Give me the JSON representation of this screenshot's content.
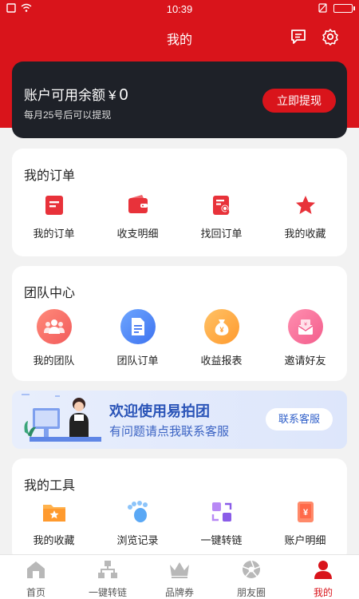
{
  "status_bar": {
    "time": "10:39"
  },
  "header": {
    "title": "我的",
    "message_icon": "message-icon",
    "settings_icon": "gear-icon"
  },
  "balance": {
    "label": "账户可用余额",
    "currency": "¥",
    "amount": "0",
    "note": "每月25号后可以提现",
    "withdraw_label": "立即提现"
  },
  "orders": {
    "title": "我的订单",
    "items": [
      {
        "label": "我的订单",
        "icon": "order-list-icon"
      },
      {
        "label": "收支明细",
        "icon": "wallet-icon"
      },
      {
        "label": "找回订单",
        "icon": "search-order-icon"
      },
      {
        "label": "我的收藏",
        "icon": "star-icon"
      }
    ]
  },
  "team": {
    "title": "团队中心",
    "items": [
      {
        "label": "我的团队",
        "icon": "team-icon"
      },
      {
        "label": "团队订单",
        "icon": "document-icon"
      },
      {
        "label": "收益报表",
        "icon": "money-bag-icon"
      },
      {
        "label": "邀请好友",
        "icon": "invite-icon"
      }
    ]
  },
  "banner": {
    "title": "欢迎使用易拍团",
    "subtitle": "有问题请点我联系客服",
    "button_label": "联系客服"
  },
  "tools": {
    "title": "我的工具",
    "items": [
      {
        "label": "我的收藏",
        "icon": "folder-star-icon"
      },
      {
        "label": "浏览记录",
        "icon": "footprint-icon"
      },
      {
        "label": "一键转链",
        "icon": "convert-link-icon"
      },
      {
        "label": "账户明细",
        "icon": "account-detail-icon"
      }
    ]
  },
  "tabbar": {
    "active": "我的",
    "tabs": [
      {
        "label": "首页",
        "icon": "home-icon"
      },
      {
        "label": "一键转链",
        "icon": "network-icon"
      },
      {
        "label": "品牌券",
        "icon": "crown-icon"
      },
      {
        "label": "朋友圈",
        "icon": "aperture-icon"
      },
      {
        "label": "我的",
        "icon": "user-icon"
      }
    ]
  },
  "colors": {
    "brand_red": "#d9141b",
    "card_dark": "#1e2128",
    "banner_blue": "#2a54b8"
  }
}
